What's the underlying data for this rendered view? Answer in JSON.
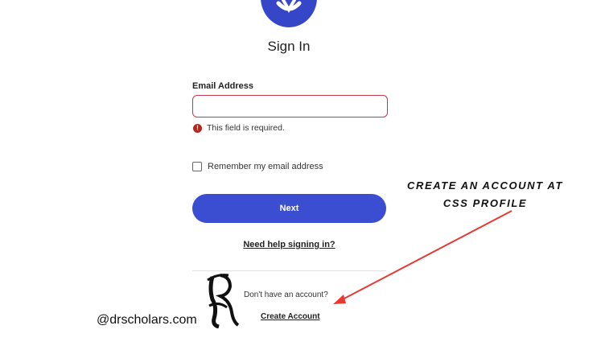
{
  "header": {
    "title": "Sign In"
  },
  "form": {
    "email_label": "Email Address",
    "email_value": "",
    "error_text": "This field is required.",
    "remember_label": "Remember my email address",
    "remember_checked": false,
    "next_label": "Next",
    "help_link": "Need help signing in?"
  },
  "footer": {
    "no_account_text": "Don't have an account?",
    "create_account_link": "Create Account"
  },
  "overlay": {
    "annotation_line1": "CREATE AN ACCOUNT AT",
    "annotation_line2": "CSS PROFILE",
    "handle": "@drscholars.com",
    "arrow_color": "#e53935"
  },
  "colors": {
    "brand": "#3646c8",
    "button": "#3b4ed1",
    "error": "#b3261e",
    "error_border": "#c8374a"
  },
  "icons": {
    "logo": "shield-logo-icon",
    "error": "exclamation-circle-icon",
    "monogram": "dr-monogram-icon"
  }
}
